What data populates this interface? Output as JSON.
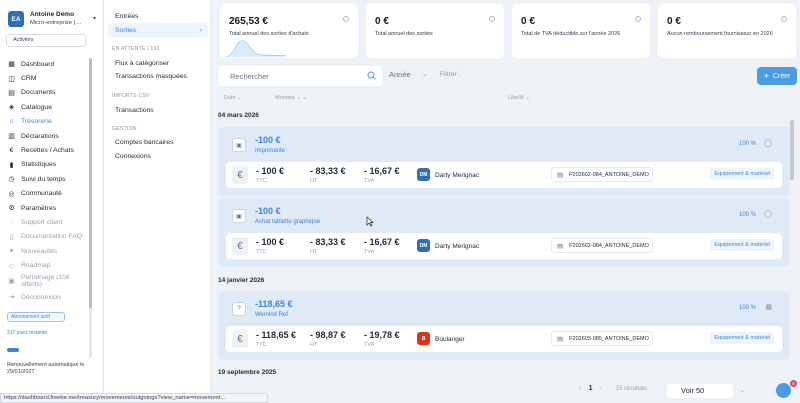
{
  "account": {
    "initials": "EA",
    "name": "Antoine Démo",
    "type": "Micro-entreprise | ..."
  },
  "activity_label": "Activités",
  "nav": [
    {
      "label": "Dashboard",
      "icon": "grid-icon"
    },
    {
      "label": "CRM",
      "icon": "users-icon"
    },
    {
      "label": "Documents",
      "icon": "file-icon"
    },
    {
      "label": "Catalogue",
      "icon": "box-icon"
    },
    {
      "label": "Trésorerie",
      "icon": "bank-icon"
    },
    {
      "label": "Déclarations",
      "icon": "doc-icon"
    },
    {
      "label": "Recettes / Achats",
      "icon": "euro-icon"
    },
    {
      "label": "Statistiques",
      "icon": "chart-icon"
    },
    {
      "label": "Suivi du temps",
      "icon": "clock-icon"
    },
    {
      "label": "Communauté",
      "icon": "community-icon"
    },
    {
      "label": "Paramètres",
      "icon": "gear-icon"
    }
  ],
  "nav_secondary": [
    {
      "label": "Support client",
      "icon": "chat-icon"
    },
    {
      "label": "Documentation FAQ",
      "icon": "book-icon"
    },
    {
      "label": "Nouveautés",
      "icon": "sparkle-icon"
    },
    {
      "label": "Roadmap",
      "icon": "map-icon"
    },
    {
      "label": "Parrainage (15€ offerts)",
      "icon": "gift-icon"
    },
    {
      "label": "Déconnexion",
      "icon": "logout-icon"
    }
  ],
  "subscription": {
    "button": "Abonnement actif",
    "days": "317 jours restants",
    "progress": 0.13,
    "renewal": "Renouvellement automatique le 29/01/2027"
  },
  "submenu": {
    "entries": "Entrées",
    "outgoing": "Sorties",
    "pending_head": "EN ATTENTE | 193",
    "to_categorize": "Flux à catégoriser",
    "hidden": "Transactions masquées",
    "imports_head": "IMPORTS CSV",
    "transactions": "Transactions",
    "gestion_head": "GESTION",
    "bank_accounts": "Comptes bancaires",
    "connections": "Connexions"
  },
  "kpis": [
    {
      "value": "265,53 €",
      "label": "Total annuel des sorties d'achats"
    },
    {
      "value": "0 €",
      "label": "Total annuel des sorties"
    },
    {
      "value": "0 €",
      "label": "Total de TVA déductible sur l'année 2026"
    },
    {
      "value": "0 €",
      "label": "Aucun remboursement fournisseur en 2026"
    }
  ],
  "toolbar": {
    "search_placeholder": "Rechercher",
    "year": "Année",
    "filter": "Filtrer",
    "create": "Créer"
  },
  "columns": {
    "date": "Date",
    "amount": "Montant",
    "label": "Libellé"
  },
  "groups": [
    {
      "date": "04 mars 2026"
    },
    {
      "date": "14 janvier 2026"
    },
    {
      "date": "19 septembre 2025"
    }
  ],
  "transactions": [
    {
      "amount": "-100 €",
      "title": "Imprimante",
      "pct": "100 %",
      "ttc": "- 100 €",
      "ht": "- 83,33 €",
      "tva": "- 16,67 €",
      "vendor": "Darty Merignac",
      "vendor_logo": "DM",
      "vendor_color": "#2e6fb7",
      "ref": "F202602-084_ANTOINE_DEMO",
      "category": "Equipement & matériel",
      "icon": "image-icon"
    },
    {
      "amount": "-100 €",
      "title": "Achat tablette graphique",
      "pct": "100 %",
      "ttc": "- 100 €",
      "ht": "- 83,33 €",
      "tva": "- 16,67 €",
      "vendor": "Darty Merignac",
      "vendor_logo": "DM",
      "vendor_color": "#2e6fb7",
      "ref": "F202602-084_ANTOINE_DEMO",
      "category": "Equipement & matériel",
      "icon": "image-icon"
    },
    {
      "amount": "-118,65 €",
      "title": "Wemind Ref",
      "pct": "100 %",
      "ttc": "- 118,65 €",
      "ht": "- 98,87 €",
      "tva": "- 19,78 €",
      "vendor": "Boulanger",
      "vendor_logo": "B",
      "vendor_color": "#e3321c",
      "ref": "F202603-085_ANTOINE_DEMO",
      "category": "Equipement & matériel",
      "icon": "question-icon"
    }
  ],
  "labels": {
    "ttc": "TTC",
    "ht": "HT",
    "tva": "TVA"
  },
  "pagination": {
    "page": "1",
    "results": "15 résultats",
    "per_page": "Voir 50"
  },
  "notifications": "8",
  "status_url": "https://dashboard.freebe.me/treasury/movements/outgoings?view_name=movement..."
}
